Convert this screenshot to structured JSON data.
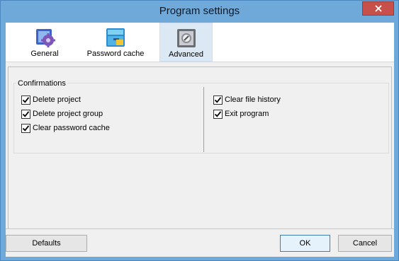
{
  "window": {
    "title": "Program settings"
  },
  "tabs": [
    {
      "label": "General",
      "icon": "gear-icon"
    },
    {
      "label": "Password cache",
      "icon": "drawer-icon"
    },
    {
      "label": "Advanced",
      "icon": "safe-icon",
      "active": true
    }
  ],
  "confirmations": {
    "title": "Confirmations",
    "left": [
      {
        "label": "Delete project",
        "checked": true
      },
      {
        "label": "Delete project group",
        "checked": true
      },
      {
        "label": "Clear password cache",
        "checked": true
      }
    ],
    "right": [
      {
        "label": "Clear file history",
        "checked": true
      },
      {
        "label": "Exit program",
        "checked": true
      }
    ]
  },
  "buttons": {
    "defaults": "Defaults",
    "ok": "OK",
    "cancel": "Cancel"
  },
  "colors": {
    "accent": "#6ea9d9",
    "active_tab": "#dce8f3",
    "close": "#c7504a"
  }
}
